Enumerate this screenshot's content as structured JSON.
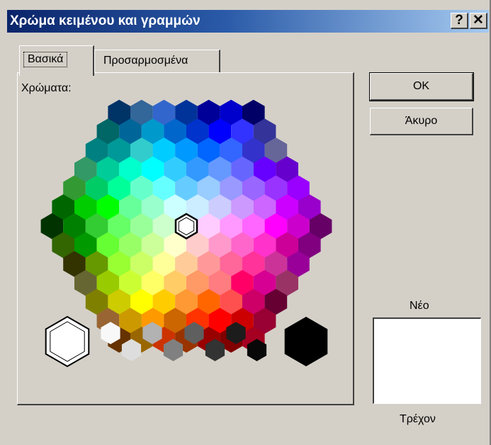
{
  "window": {
    "title": "Χρώμα κειμένου και γραμμών",
    "help_label": "?",
    "close_label": "✕"
  },
  "tabs": [
    {
      "label": "Βασικά",
      "selected": true
    },
    {
      "label": "Προσαρμοσμένα",
      "selected": false
    }
  ],
  "panel": {
    "colors_label": "Χρώματα:"
  },
  "buttons": {
    "ok_label": "OK",
    "cancel_label": "Άκυρο"
  },
  "preview": {
    "new_label": "Νέο",
    "current_label": "Τρέχον",
    "new_color": "#ffffff",
    "current_color": "#ffffff"
  },
  "palette": {
    "selected_color": "#ffffff",
    "rows": [
      [
        "#003366",
        "#336699",
        "#3366cc",
        "#003399",
        "#000099",
        "#0000cc",
        "#000066"
      ],
      [
        "#006666",
        "#006699",
        "#0099cc",
        "#0066cc",
        "#0033cc",
        "#0000ff",
        "#3333ff",
        "#333399"
      ],
      [
        "#008080",
        "#009999",
        "#33cccc",
        "#00ccff",
        "#0099ff",
        "#0066ff",
        "#3366ff",
        "#3333cc",
        "#666699"
      ],
      [
        "#339966",
        "#00cc99",
        "#00ffcc",
        "#00ffff",
        "#33ccff",
        "#3399ff",
        "#6699ff",
        "#6666ff",
        "#6600ff",
        "#6600cc"
      ],
      [
        "#339933",
        "#00cc66",
        "#00ff99",
        "#66ffcc",
        "#66ffff",
        "#66ccff",
        "#99ccff",
        "#9999ff",
        "#9966ff",
        "#9933ff",
        "#9900ff"
      ],
      [
        "#006600",
        "#00cc00",
        "#00ff00",
        "#66ff99",
        "#99ffcc",
        "#ccffff",
        "#ccecff",
        "#ccccff",
        "#cc99ff",
        "#cc66ff",
        "#cc00ff",
        "#9900cc"
      ],
      [
        "#003300",
        "#008000",
        "#33cc33",
        "#66ff66",
        "#99ff99",
        "#ccffcc",
        "#ffffff",
        "#ffccff",
        "#ff99ff",
        "#ff66ff",
        "#ff00ff",
        "#cc00cc",
        "#660066"
      ],
      [
        "#336600",
        "#009900",
        "#66ff33",
        "#99ff66",
        "#ccff99",
        "#ffffcc",
        "#ffcccc",
        "#ff99cc",
        "#ff66cc",
        "#ff33cc",
        "#cc0099",
        "#800080"
      ],
      [
        "#333300",
        "#669900",
        "#99ff33",
        "#ccff66",
        "#ffff99",
        "#ffcc99",
        "#ff9999",
        "#ff6699",
        "#ff3399",
        "#cc3399",
        "#990099"
      ],
      [
        "#666633",
        "#99cc00",
        "#ccff33",
        "#ffff66",
        "#ffcc66",
        "#ff9966",
        "#ff7c80",
        "#ff0066",
        "#d60093",
        "#993366"
      ],
      [
        "#808000",
        "#cccc00",
        "#ffff00",
        "#ffcc00",
        "#ff9933",
        "#ff6600",
        "#ff5050",
        "#cc0066",
        "#660033"
      ],
      [
        "#996633",
        "#cc9900",
        "#ff9900",
        "#cc6600",
        "#ff3300",
        "#ff0000",
        "#cc0000",
        "#990033"
      ],
      [
        "#663300",
        "#996600",
        "#cc3300",
        "#993300",
        "#990000",
        "#800000",
        "#a50021"
      ]
    ],
    "grays": [
      "#f8f8f8",
      "#dddddd",
      "#b2b2b2",
      "#808080",
      "#5f5f5f",
      "#333333",
      "#1c1c1c",
      "#080808"
    ],
    "black": "#000000",
    "white": "#ffffff"
  }
}
